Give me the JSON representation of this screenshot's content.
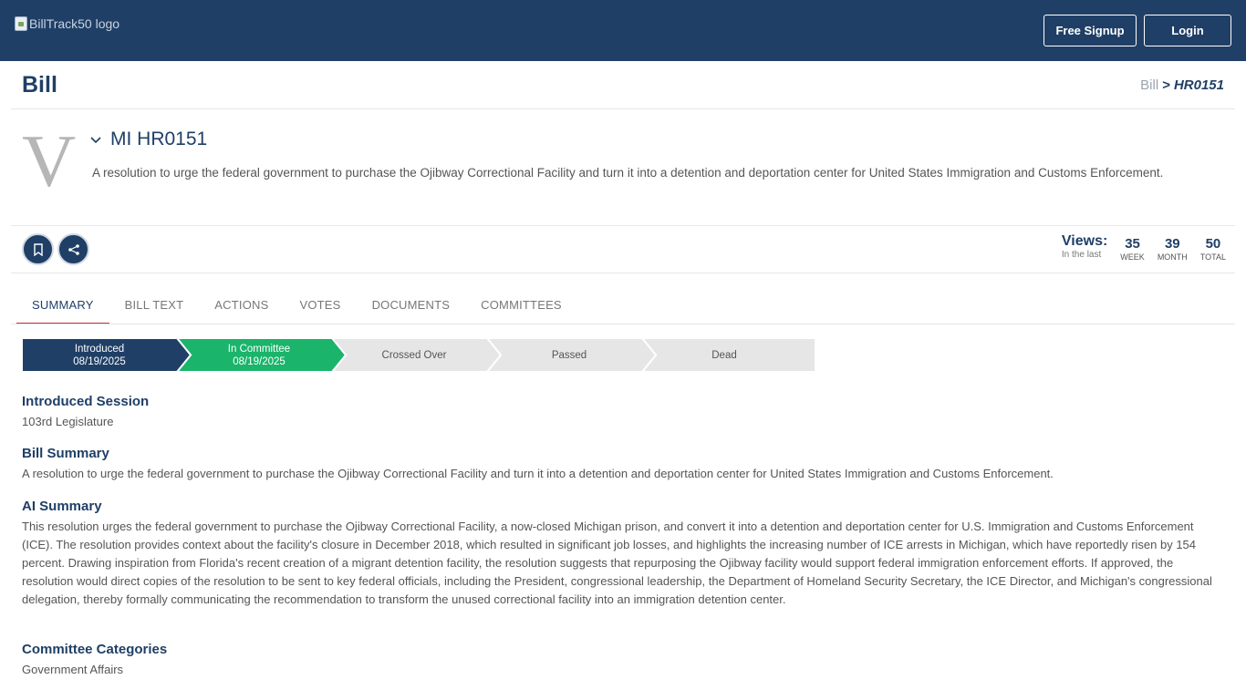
{
  "header": {
    "logo_alt": "BillTrack50 logo",
    "signup_label": "Free Signup",
    "login_label": "Login"
  },
  "page": {
    "title": "Bill",
    "breadcrumb": {
      "root": "Bill",
      "separator": ">",
      "current": "HR0151"
    }
  },
  "bill": {
    "letter": "V",
    "id": "MI HR0151",
    "description": "A resolution to urge the federal government to purchase the Ojibway Correctional Facility and turn it into a detention and deportation center for United States Immigration and Customs Enforcement."
  },
  "actions": {
    "icon1": "bookmark-icon",
    "icon2": "share-icon"
  },
  "views": {
    "label": "Views:",
    "sublabel": "In the last",
    "week": {
      "value": "35",
      "label": "WEEK"
    },
    "month": {
      "value": "39",
      "label": "MONTH"
    },
    "total": {
      "value": "50",
      "label": "TOTAL"
    }
  },
  "tabs": [
    {
      "label": "SUMMARY",
      "active": true
    },
    {
      "label": "BILL TEXT"
    },
    {
      "label": "ACTIONS"
    },
    {
      "label": "VOTES"
    },
    {
      "label": "DOCUMENTS"
    },
    {
      "label": "COMMITTEES"
    }
  ],
  "progress": [
    {
      "label": "Introduced",
      "date": "08/19/2025",
      "color": "#1f3f66"
    },
    {
      "label": "In Committee",
      "date": "08/19/2025",
      "color": "#1ab46a"
    },
    {
      "label": "Crossed Over",
      "date": "",
      "color": "#e6e6e6"
    },
    {
      "label": "Passed",
      "date": "",
      "color": "#e6e6e6"
    },
    {
      "label": "Dead",
      "date": "",
      "color": "#e6e6e6"
    }
  ],
  "sections": {
    "session": {
      "title": "Introduced Session",
      "body": "103rd Legislature"
    },
    "summary": {
      "title": "Bill Summary",
      "body": "A resolution to urge the federal government to purchase the Ojibway Correctional Facility and turn it into a detention and deportation center for United States Immigration and Customs Enforcement."
    },
    "ai_summary": {
      "title": "AI Summary",
      "body": "This resolution urges the federal government to purchase the Ojibway Correctional Facility, a now-closed Michigan prison, and convert it into a detention and deportation center for U.S. Immigration and Customs Enforcement (ICE). The resolution provides context about the facility's closure in December 2018, which resulted in significant job losses, and highlights the increasing number of ICE arrests in Michigan, which have reportedly risen by 154 percent. Drawing inspiration from Florida's recent creation of a migrant detention facility, the resolution suggests that repurposing the Ojibway facility would support federal immigration enforcement efforts. If approved, the resolution would direct copies of the resolution to be sent to key federal officials, including the President, congressional leadership, the Department of Homeland Security Secretary, the ICE Director, and Michigan's congressional delegation, thereby formally communicating the recommendation to transform the unused correctional facility into an immigration detention center."
    },
    "committee": {
      "title": "Committee Categories",
      "body": "Government Affairs"
    }
  }
}
